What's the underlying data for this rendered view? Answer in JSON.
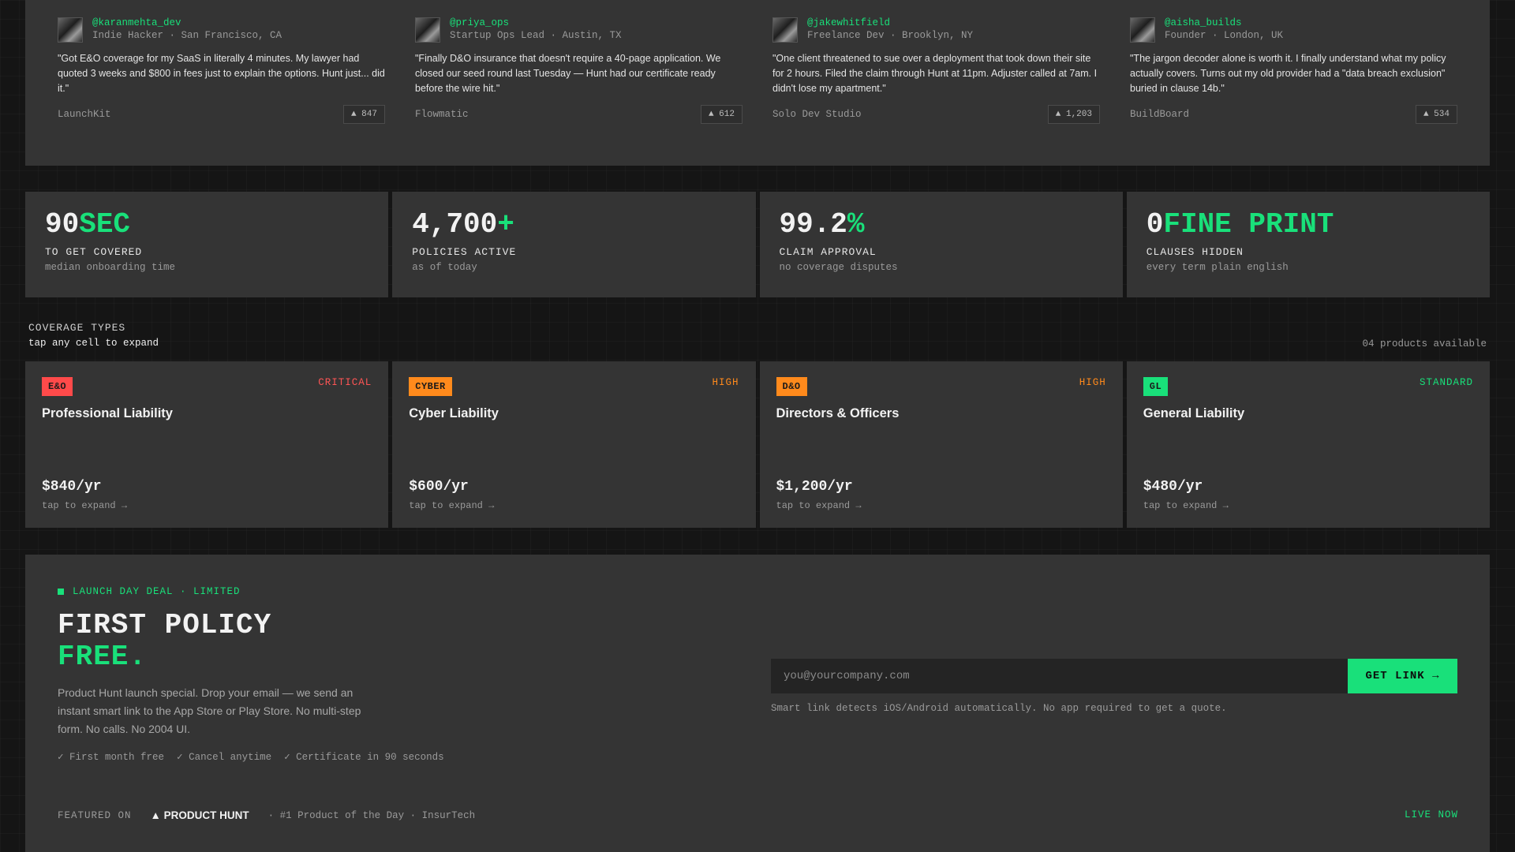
{
  "testimonials": [
    {
      "handle": "@karanmehta_dev",
      "role": "Indie Hacker · San Francisco, CA",
      "quote": "\"Got E&O coverage for my SaaS in literally 4 minutes. My lawyer had quoted 3 weeks and $800 in fees just to explain the options. Hunt just... did it.\"",
      "company": "LaunchKit",
      "votes": "▲ 847"
    },
    {
      "handle": "@priya_ops",
      "role": "Startup Ops Lead · Austin, TX",
      "quote": "\"Finally D&O insurance that doesn't require a 40-page application. We closed our seed round last Tuesday — Hunt had our certificate ready before the wire hit.\"",
      "company": "Flowmatic",
      "votes": "▲ 612"
    },
    {
      "handle": "@jakewhitfield",
      "role": "Freelance Dev · Brooklyn, NY",
      "quote": "\"One client threatened to sue over a deployment that took down their site for 2 hours. Filed the claim through Hunt at 11pm. Adjuster called at 7am. I didn't lose my apartment.\"",
      "company": "Solo Dev Studio",
      "votes": "▲ 1,203"
    },
    {
      "handle": "@aisha_builds",
      "role": "Founder · London, UK",
      "quote": "\"The jargon decoder alone is worth it. I finally understand what my policy actually covers. Turns out my old provider had a \"data breach exclusion\" buried in clause 14b.\"",
      "company": "BuildBoard",
      "votes": "▲ 534"
    }
  ],
  "stats": [
    {
      "number": "90",
      "accent": "SEC",
      "label": "TO GET COVERED",
      "sub": "median onboarding time"
    },
    {
      "number": "4,700",
      "accent": "+",
      "label": "POLICIES ACTIVE",
      "sub": "as of today"
    },
    {
      "number": "99.2",
      "accent": "%",
      "label": "CLAIM APPROVAL",
      "sub": "no coverage disputes"
    },
    {
      "number": "0",
      "accent": "FINE PRINT",
      "label": "CLAUSES HIDDEN",
      "sub": "every term plain english"
    }
  ],
  "coverage": {
    "title": "COVERAGE TYPES",
    "subtitle": "tap any cell to expand",
    "count": "04 products available",
    "items": [
      {
        "badge": "E&O",
        "badge_color": "#ff4a4a",
        "level": "CRITICAL",
        "level_color": "#ff5555",
        "name": "Professional Liability",
        "price": "$840/yr",
        "expand": "tap to expand →"
      },
      {
        "badge": "CYBER",
        "badge_color": "#ff8a1c",
        "level": "HIGH",
        "level_color": "#ff8a1c",
        "name": "Cyber Liability",
        "price": "$600/yr",
        "expand": "tap to expand →"
      },
      {
        "badge": "D&O",
        "badge_color": "#ff8a1c",
        "level": "HIGH",
        "level_color": "#ff8a1c",
        "name": "Directors & Officers",
        "price": "$1,200/yr",
        "expand": "tap to expand →"
      },
      {
        "badge": "GL",
        "badge_color": "#19e07a",
        "level": "STANDARD",
        "level_color": "#19e07a",
        "name": "General Liability",
        "price": "$480/yr",
        "expand": "tap to expand →"
      }
    ]
  },
  "cta": {
    "deal": "LAUNCH DAY DEAL · LIMITED",
    "headline_line1": "FIRST POLICY",
    "headline_line2": "FREE.",
    "description": "Product Hunt launch special. Drop your email — we send an instant smart link to the App Store or Play Store. No multi-step form. No calls. No 2004 UI.",
    "checks": [
      "✓ First month free",
      "✓ Cancel anytime",
      "✓ Certificate in 90 seconds"
    ],
    "email_placeholder": "you@yourcompany.com",
    "button_label": "GET LINK →",
    "smart_note": "Smart link detects iOS/Android automatically. No app required to get a quote.",
    "featured_label": "FEATURED ON",
    "product_hunt": "▲ PRODUCT HUNT",
    "ph_meta": "· #1 Product of the Day · InsurTech",
    "live": "LIVE NOW"
  },
  "colors": {
    "accent": "#19e07a",
    "panel": "#343434",
    "background": "#151515"
  }
}
